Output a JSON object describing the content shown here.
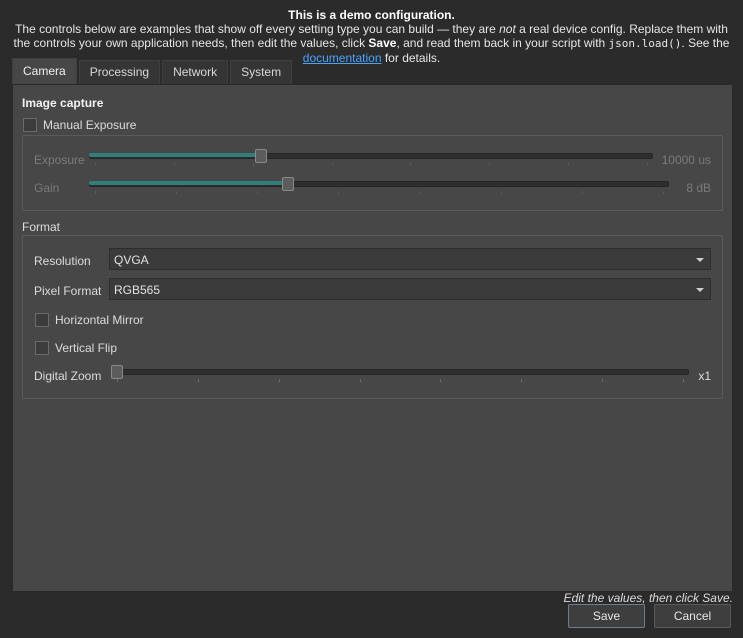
{
  "banner": {
    "title": "This is a demo configuration.",
    "line1": "The controls below are examples that show off every setting type you can build — they are ",
    "line1_em": "not",
    "line1_end": " a real device config. Replace them with",
    "line2_start": "the controls your own application needs, then edit the values, click ",
    "line2_bold": "Save",
    "line2_mid": ", and read them back in your script with ",
    "line2_code": "json.load()",
    "line2_end": ". See the",
    "link": "documentation",
    "line3_end": " for details."
  },
  "tabs": [
    {
      "label": "Camera",
      "active": true
    },
    {
      "label": "Processing",
      "active": false
    },
    {
      "label": "Network",
      "active": false
    },
    {
      "label": "System",
      "active": false
    }
  ],
  "camera": {
    "image_capture_title": "Image capture",
    "manual_exposure_label": "Manual Exposure",
    "manual_exposure_checked": false,
    "exposure": {
      "label": "Exposure",
      "value_text": "10000 us",
      "fraction": 0.3
    },
    "gain": {
      "label": "Gain",
      "value_text": "8 dB",
      "fraction": 0.34
    },
    "format_title": "Format",
    "resolution": {
      "label": "Resolution",
      "value": "QVGA"
    },
    "pixel_format": {
      "label": "Pixel Format",
      "value": "RGB565"
    },
    "horizontal_mirror_label": "Horizontal Mirror",
    "horizontal_mirror_checked": false,
    "vertical_flip_label": "Vertical Flip",
    "vertical_flip_checked": false,
    "digital_zoom": {
      "label": "Digital Zoom",
      "value_text": "x1",
      "fraction": 0
    }
  },
  "footer": {
    "hint": "Edit the values, then click Save.",
    "save_label": "Save",
    "cancel_label": "Cancel"
  },
  "colors": {
    "accent": "#2f7f7f",
    "background": "#2b2b2b",
    "panel": "#474747",
    "link": "#4aa3ff"
  }
}
